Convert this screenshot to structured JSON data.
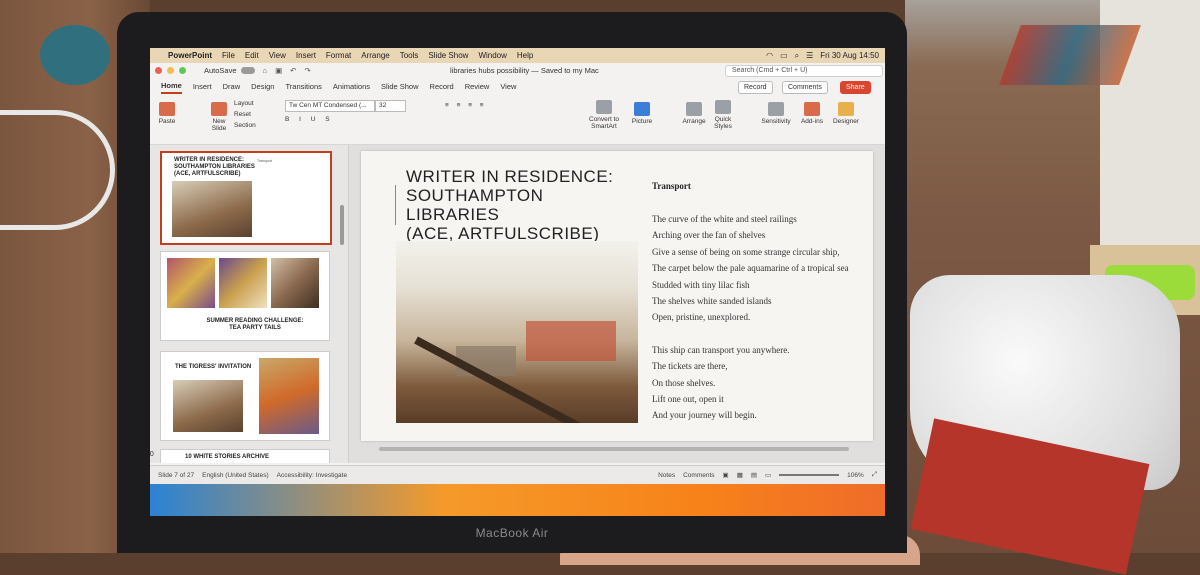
{
  "menubar": {
    "app": "PowerPoint",
    "items": [
      "File",
      "Edit",
      "View",
      "Insert",
      "Format",
      "Arrange",
      "Tools",
      "Slide Show",
      "Window",
      "Help"
    ],
    "clock": "Fri 30 Aug  14:50"
  },
  "window": {
    "autosave": "AutoSave",
    "doc_title": "libraries hubs possibility — Saved to my Mac",
    "search_placeholder": "Search (Cmd + Ctrl + U)"
  },
  "tabs": [
    "Home",
    "Insert",
    "Draw",
    "Design",
    "Transitions",
    "Animations",
    "Slide Show",
    "Record",
    "Review",
    "View"
  ],
  "tab_buttons": {
    "record": "Record",
    "comments": "Comments",
    "share": "Share"
  },
  "ribbon": {
    "paste": "Paste",
    "new_slide": "New\nSlide",
    "layout": "Layout",
    "reset": "Reset",
    "section": "Section",
    "font": "Tw Cen MT Condensed (...",
    "size": "32",
    "convert": "Convert to\nSmartArt",
    "picture": "Picture",
    "arrange": "Arrange",
    "quick_styles": "Quick\nStyles",
    "sensitivity": "Sensitivity",
    "addins": "Add-ins",
    "designer": "Designer"
  },
  "thumbnails": [
    {
      "num": "7",
      "title": "WRITER IN RESIDENCE:\nSOUTHAMPTON LIBRARIES\n(ACE, ARTFULSCRIBE)",
      "side": "Transport"
    },
    {
      "num": "8",
      "title": "SUMMER READING CHALLENGE:\nTEA PARTY TAILS"
    },
    {
      "num": "9",
      "title": "THE TIGRESS' INVITATION"
    },
    {
      "num": "10",
      "title": "10 WHITE STORIES ARCHIVE"
    }
  ],
  "slide": {
    "title_lines": [
      "WRITER IN RESIDENCE:",
      "SOUTHAMPTON LIBRARIES",
      "(ACE, ARTFULSCRIBE)"
    ],
    "poem_title": "Transport",
    "stanza1": [
      "The curve of the white and steel railings",
      "Arching over the fan of shelves",
      "Give a sense of being on some strange circular ship,",
      "The carpet below the pale aquamarine of a tropical sea",
      "Studded with tiny lilac fish",
      "The shelves white sanded islands",
      "Open, pristine, unexplored."
    ],
    "stanza2": [
      "This ship can transport you anywhere.",
      "The tickets are there,",
      "On those shelves.",
      "Lift one out, open it",
      "And your journey will begin."
    ]
  },
  "status": {
    "slide_count": "Slide 7 of 27",
    "language": "English (United States)",
    "accessibility": "Accessibility: Investigate",
    "notes": "Notes",
    "comments": "Comments",
    "zoom": "106%"
  },
  "laptop_label": "MacBook Air"
}
